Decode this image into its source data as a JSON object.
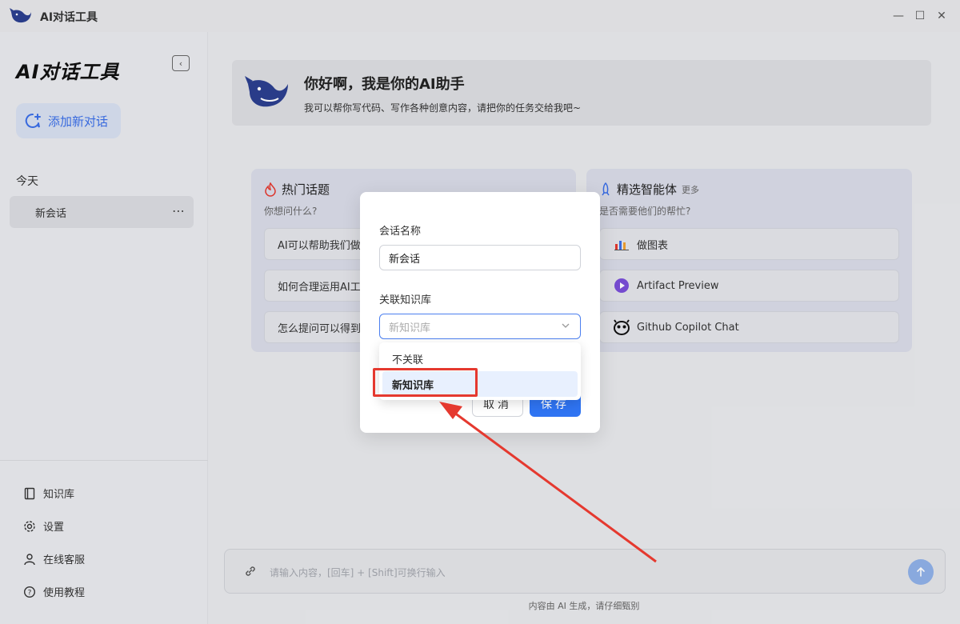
{
  "window": {
    "title": "AI对话工具",
    "controls": {
      "minimize": "—",
      "maximize": "☐",
      "close": "✕"
    }
  },
  "sidebar": {
    "brand": "AI对话工具",
    "new_chat_label": "添加新对话",
    "group_today": "今天",
    "conversations": [
      {
        "label": "新会话",
        "more": "⋯"
      }
    ],
    "menu": [
      {
        "label": "知识库",
        "icon": "book-icon"
      },
      {
        "label": "设置",
        "icon": "gear-icon"
      },
      {
        "label": "在线客服",
        "icon": "user-icon"
      },
      {
        "label": "使用教程",
        "icon": "help-icon"
      }
    ]
  },
  "welcome": {
    "title": "你好啊，我是你的AI助手",
    "subtitle": "我可以帮你写代码、写作各种创意内容，请把你的任务交给我吧~"
  },
  "hot_topics": {
    "title": "热门话题",
    "subtitle": "你想问什么?",
    "items": [
      "AI可以帮助我们做",
      "如何合理运用AI工",
      "怎么提问可以得到"
    ]
  },
  "agents": {
    "title": "精选智能体",
    "more": "更多",
    "subtitle": "是否需要他们的帮忙?",
    "items": [
      {
        "label": "做图表",
        "icon": "chart-icon"
      },
      {
        "label": "Artifact Preview",
        "icon": "play-icon"
      },
      {
        "label": "Github Copilot Chat",
        "icon": "copilot-icon"
      }
    ]
  },
  "input": {
    "placeholder": "请输入内容，[回车] + [Shift]可换行输入"
  },
  "disclaimer": "内容由 AI 生成，请仔细甄别",
  "modal": {
    "name_label": "会话名称",
    "name_value": "新会话",
    "kb_label": "关联知识库",
    "kb_placeholder": "新知识库",
    "options": [
      "不关联",
      "新知识库"
    ],
    "selected_option": "新知识库",
    "cancel": "取消",
    "save": "保存"
  },
  "colors": {
    "accent": "#2f74f2",
    "annotation": "#e5392f"
  }
}
